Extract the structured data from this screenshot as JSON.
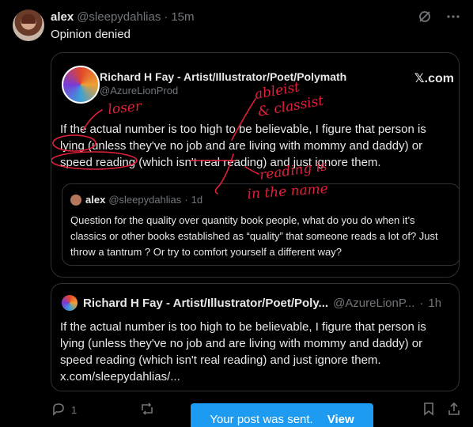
{
  "post": {
    "author_name": "alex",
    "author_handle": "@sleepydahlias",
    "separator": "·",
    "time": "15m",
    "text": "Opinion denied",
    "icons": [
      "grok-icon",
      "more-icon"
    ]
  },
  "quoted_card": {
    "author_name": "Richard H Fay - Artist/Illustrator/Poet/Polymath",
    "author_handle": "@AzureLionProd",
    "brand": "𝕏.com",
    "text": "If the actual number is too high to be believable, I figure that person is lying (unless they've no job and are living with mommy and daddy) or speed reading (which isn't real reading) and just ignore them.",
    "inner_quote": {
      "author_name": "alex",
      "author_handle": "@sleepydahlias",
      "separator": "·",
      "time": "1d",
      "text": "Question for the quality over quantity book people, what do you do when it’s classics or other books established as “quality” that someone reads a lot of? Just throw a tantrum ? Or try to comfort yourself a different way?"
    },
    "annotations": {
      "loser": "loser",
      "ableist_1": "ableist",
      "ableist_2": "& classist",
      "reading_1": "reading is",
      "reading_2": "in the name",
      "color": "#e0203a"
    }
  },
  "quote_tweet": {
    "author_name": "Richard H Fay - Artist/Illustrator/Poet/Poly...",
    "author_handle": "@AzureLionP...",
    "separator": "·",
    "time": "1h",
    "text": "If the actual number is too high to be believable, I figure that person is lying (unless they've no job and are living with mommy and daddy) or speed reading (which isn't real reading) and just ignore them. x.com/sleepydahlias/..."
  },
  "actions": {
    "reply_count": "1",
    "icons": [
      "reply-icon",
      "repost-icon",
      "bookmark-icon",
      "share-icon"
    ]
  },
  "toast": {
    "message": "Your post was sent.",
    "link": "View"
  }
}
